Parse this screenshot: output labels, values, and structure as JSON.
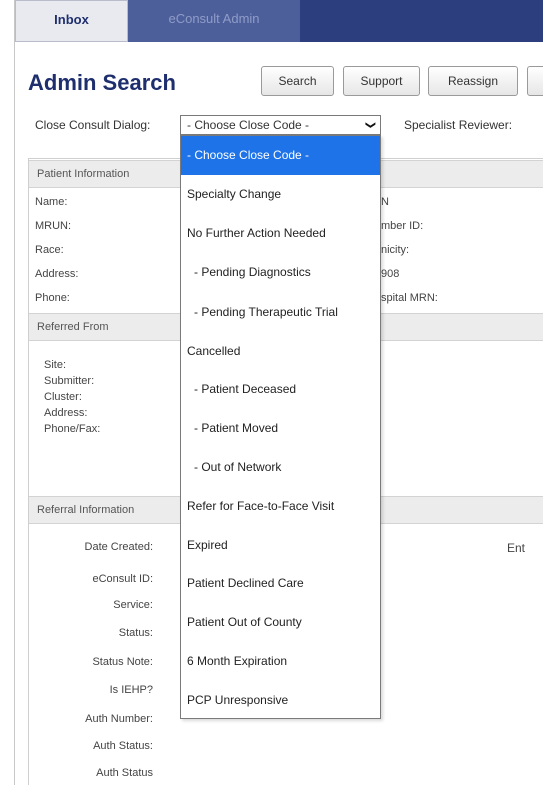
{
  "nav": {
    "tabs": [
      "Inbox",
      "eConsult Admin"
    ]
  },
  "header": {
    "title": "Admin Search",
    "buttons": [
      "Search",
      "Support",
      "Reassign"
    ]
  },
  "close_dialog": {
    "label": "Close Consult Dialog:",
    "selected": "- Choose Close Code -",
    "specialist_label": "Specialist Reviewer:"
  },
  "patient_info": {
    "heading": "Patient Information",
    "left_labels": [
      "Name:",
      "MRUN:",
      "Race:",
      "Address:",
      "Phone:"
    ],
    "right_fragments": [
      "N",
      "mber ID:",
      "nicity:",
      "908",
      "spital MRN:"
    ]
  },
  "referred_from": {
    "heading": "Referred From",
    "labels": [
      "Site:",
      "Submitter:",
      "Cluster:",
      "Address:",
      "Phone/Fax:"
    ]
  },
  "referral_info": {
    "heading": "Referral Information",
    "labels": [
      "Date Created:",
      "eConsult ID:",
      "Service:",
      "Status:",
      "Status Note:",
      "Is IEHP?",
      "Auth Number:",
      "Auth Status:",
      "Auth Status"
    ],
    "right_fragment": "Ent"
  },
  "dropdown_options": [
    "- Choose Close Code -",
    "Specialty Change",
    "No Further Action Needed",
    "- Pending Diagnostics",
    "- Pending Therapeutic Trial",
    "Cancelled",
    "- Patient Deceased",
    "- Patient Moved",
    "- Out of Network",
    "Refer for Face-to-Face Visit",
    "Expired",
    "Patient Declined Care",
    "Patient Out of County",
    "6 Month Expiration",
    "PCP Unresponsive"
  ],
  "colors": {
    "nav_bg": "#2c3e7e",
    "title": "#1f2f6e",
    "selected_option": "#1e73e8"
  }
}
